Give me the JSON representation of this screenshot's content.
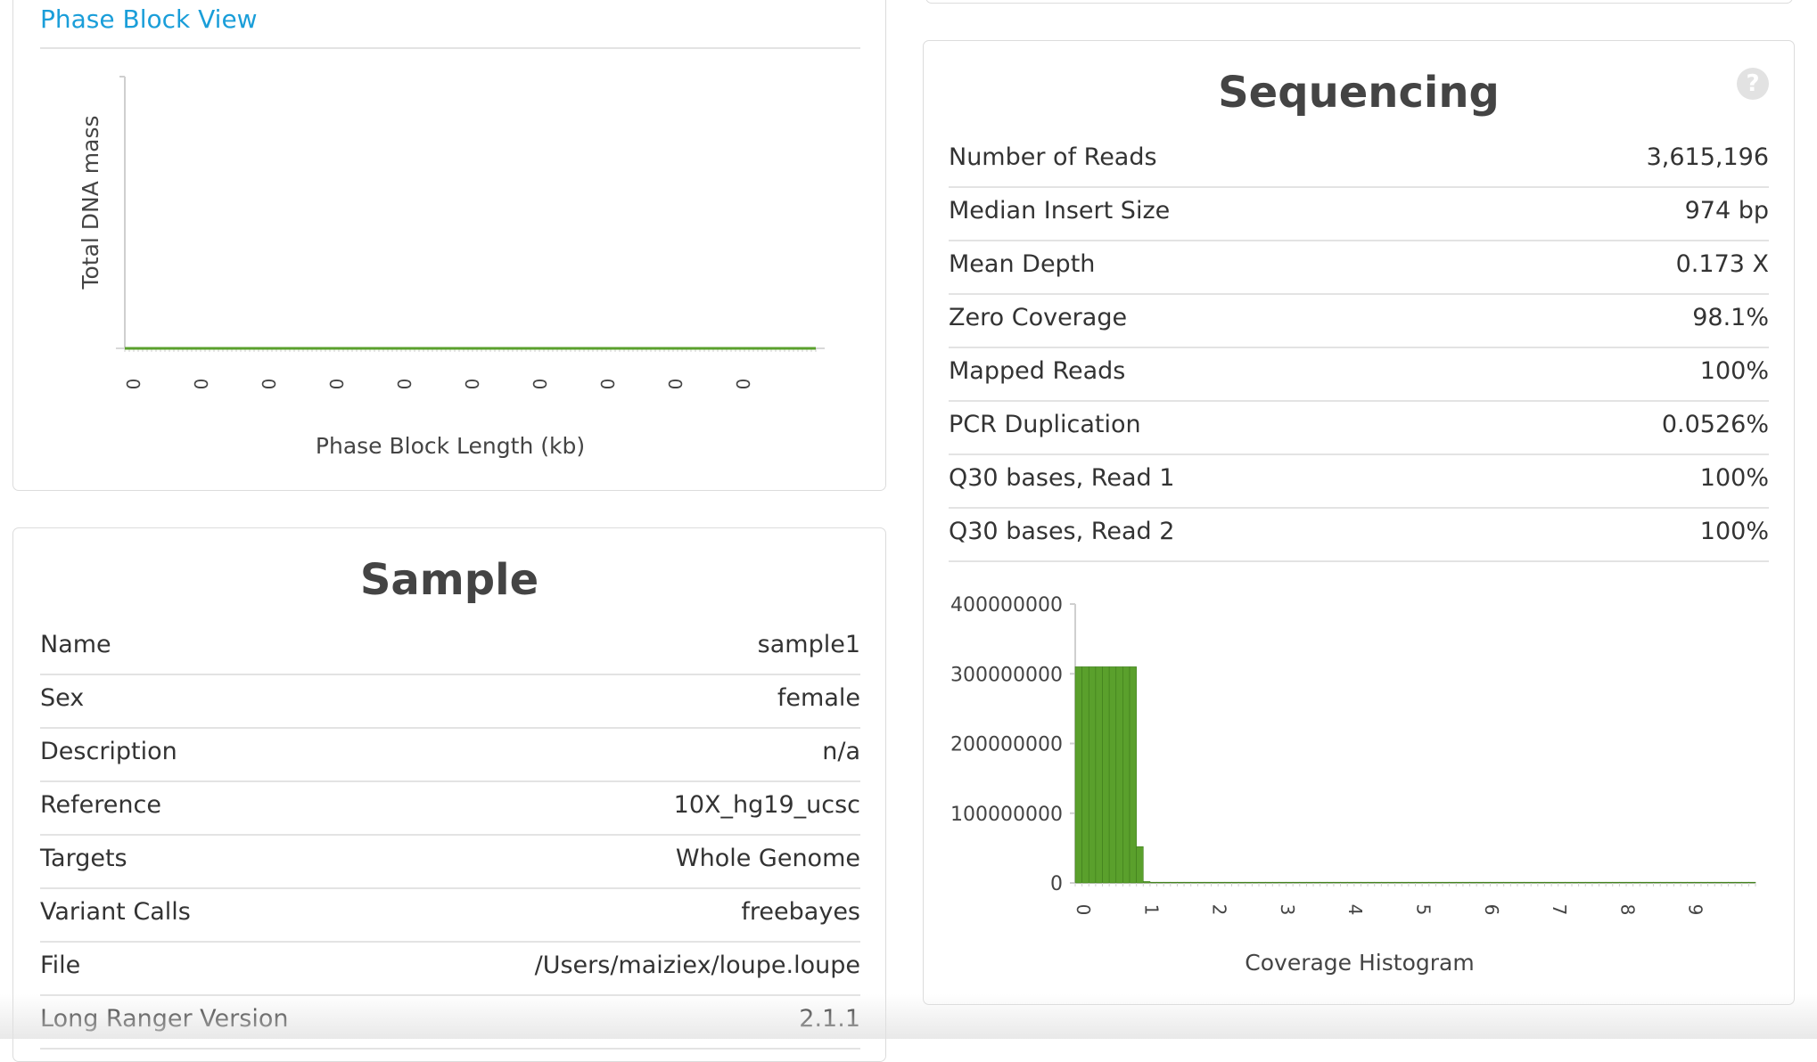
{
  "phase_block": {
    "link_title": "Phase Block View",
    "y_label": "Total DNA mass",
    "x_label": "Phase Block Length (kb)",
    "x_ticks": [
      "0",
      "0",
      "0",
      "0",
      "0",
      "0",
      "0",
      "0",
      "0",
      "0"
    ],
    "series_color": "#5aa02c"
  },
  "sample": {
    "title": "Sample",
    "rows": [
      {
        "key": "Name",
        "value": "sample1"
      },
      {
        "key": "Sex",
        "value": "female"
      },
      {
        "key": "Description",
        "value": "n/a"
      },
      {
        "key": "Reference",
        "value": "10X_hg19_ucsc"
      },
      {
        "key": "Targets",
        "value": "Whole Genome"
      },
      {
        "key": "Variant Calls",
        "value": "freebayes"
      },
      {
        "key": "File",
        "value": "/Users/maiziex/loupe.loupe"
      },
      {
        "key": "Long Ranger Version",
        "value": "2.1.1"
      }
    ]
  },
  "sequencing": {
    "title": "Sequencing",
    "help_label": "?",
    "rows": [
      {
        "key": "Number of Reads",
        "value": "3,615,196"
      },
      {
        "key": "Median Insert Size",
        "value": "974 bp"
      },
      {
        "key": "Mean Depth",
        "value": "0.173 X"
      },
      {
        "key": "Zero Coverage",
        "value": "98.1%"
      },
      {
        "key": "Mapped Reads",
        "value": "100%"
      },
      {
        "key": "PCR Duplication",
        "value": "0.0526%"
      },
      {
        "key": "Q30 bases, Read 1",
        "value": "100%"
      },
      {
        "key": "Q30 bases, Read 2",
        "value": "100%"
      }
    ]
  },
  "chart_data": [
    {
      "type": "area",
      "ylabel": "Total DNA mass",
      "xlabel": "Phase Block Length (kb)",
      "x_tick_labels": [
        "0",
        "0",
        "0",
        "0",
        "0",
        "0",
        "0",
        "0",
        "0",
        "0"
      ],
      "series": [
        {
          "values": [
            0,
            0,
            0,
            0,
            0,
            0,
            0,
            0,
            0,
            0
          ]
        }
      ],
      "color": "#5aa02c"
    },
    {
      "type": "bar",
      "xlabel": "Coverage Histogram",
      "ylim": [
        0,
        400000000
      ],
      "y_ticks": [
        0,
        100000000,
        200000000,
        300000000,
        400000000
      ],
      "y_tick_labels": [
        "0",
        "100000000",
        "200000000",
        "300000000",
        "400000000"
      ],
      "x_ticks": [
        "0",
        "1",
        "2",
        "3",
        "4",
        "5",
        "6",
        "7",
        "8",
        "9"
      ],
      "x_range": [
        0,
        10
      ],
      "bin_width": 0.1,
      "values": [
        310000000,
        310000000,
        310000000,
        310000000,
        310000000,
        310000000,
        310000000,
        310000000,
        310000000,
        52000000,
        2000000,
        1000000,
        1000000,
        1000000,
        1000000,
        1000000,
        1000000,
        1000000,
        1000000,
        1000000,
        1000000,
        1000000,
        1000000,
        1000000,
        1000000,
        1000000,
        1000000,
        1000000,
        1000000,
        1000000,
        1000000,
        1000000,
        1000000,
        1000000,
        1000000,
        1000000,
        1000000,
        1000000,
        1000000,
        1000000,
        1000000,
        1000000,
        1000000,
        1000000,
        1000000,
        1000000,
        1000000,
        1000000,
        1000000,
        1000000,
        1000000,
        1000000,
        1000000,
        1000000,
        1000000,
        1000000,
        1000000,
        1000000,
        1000000,
        1000000,
        1000000,
        1000000,
        1000000,
        1000000,
        1000000,
        1000000,
        1000000,
        1000000,
        1000000,
        1000000,
        1000000,
        1000000,
        1000000,
        1000000,
        1000000,
        1000000,
        1000000,
        1000000,
        1000000,
        1000000,
        1000000,
        1000000,
        1000000,
        1000000,
        1000000,
        1000000,
        1000000,
        1000000,
        1000000,
        1000000,
        1000000,
        1000000,
        1000000,
        1000000,
        1000000,
        1000000,
        1000000,
        1000000,
        1000000,
        1000000
      ],
      "color": "#5aa02c"
    }
  ]
}
